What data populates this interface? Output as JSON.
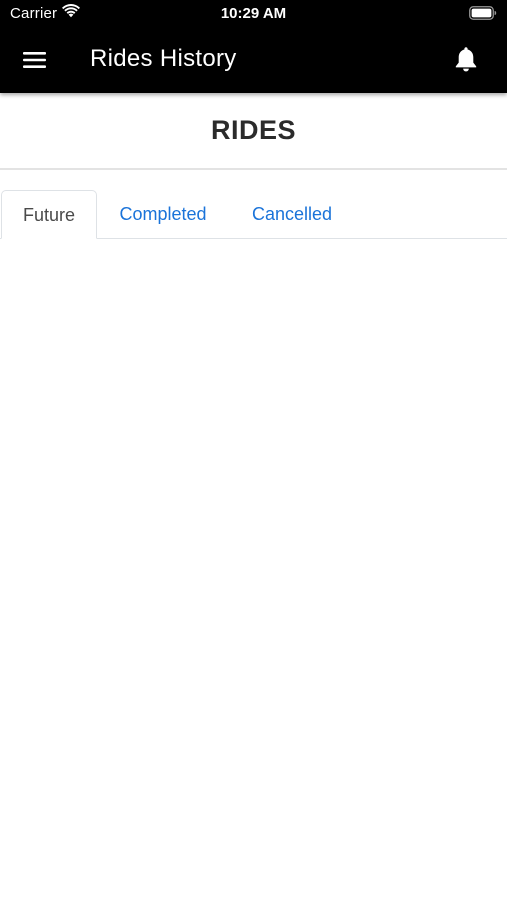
{
  "status_bar": {
    "carrier": "Carrier",
    "time": "10:29 AM",
    "wifi_icon": "wifi-icon",
    "battery_icon": "battery-icon"
  },
  "app_bar": {
    "title": "Rides History",
    "menu_icon": "hamburger-menu-icon",
    "notification_icon": "bell-icon",
    "background": "#000000",
    "foreground": "#ffffff"
  },
  "page": {
    "heading": "RIDES"
  },
  "tabs": [
    {
      "label": "Future",
      "active": true
    },
    {
      "label": "Completed",
      "active": false
    },
    {
      "label": "Cancelled",
      "active": false
    }
  ],
  "colors": {
    "link": "#1a73d9",
    "active_tab_text": "#4a4a4a",
    "heading_text": "#2b2b2b"
  }
}
